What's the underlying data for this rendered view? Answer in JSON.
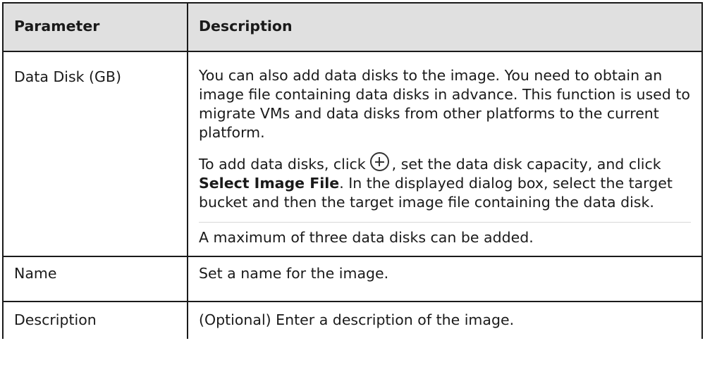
{
  "table": {
    "headers": {
      "parameter": "Parameter",
      "description": "Description"
    },
    "rows": [
      {
        "parameter": "Data Disk (GB)",
        "description": {
          "para1": "You can also add data disks to the image. You need to obtain an image file containing data disks in advance. This function is used to migrate VMs and data disks from other platforms to the current platform.",
          "para2_prefix": "To add data disks, click",
          "para2_middle": ", set the data disk capacity, and click",
          "para2_bold": "Select Image File",
          "para2_suffix": ". In the displayed dialog box, select the target bucket and then the target image file containing the data disk.",
          "para3": "A maximum of three data disks can be added."
        }
      },
      {
        "parameter": "Name",
        "description": "Set a name for the image."
      },
      {
        "parameter": "Description",
        "description": "(Optional) Enter a description of the image."
      }
    ]
  }
}
